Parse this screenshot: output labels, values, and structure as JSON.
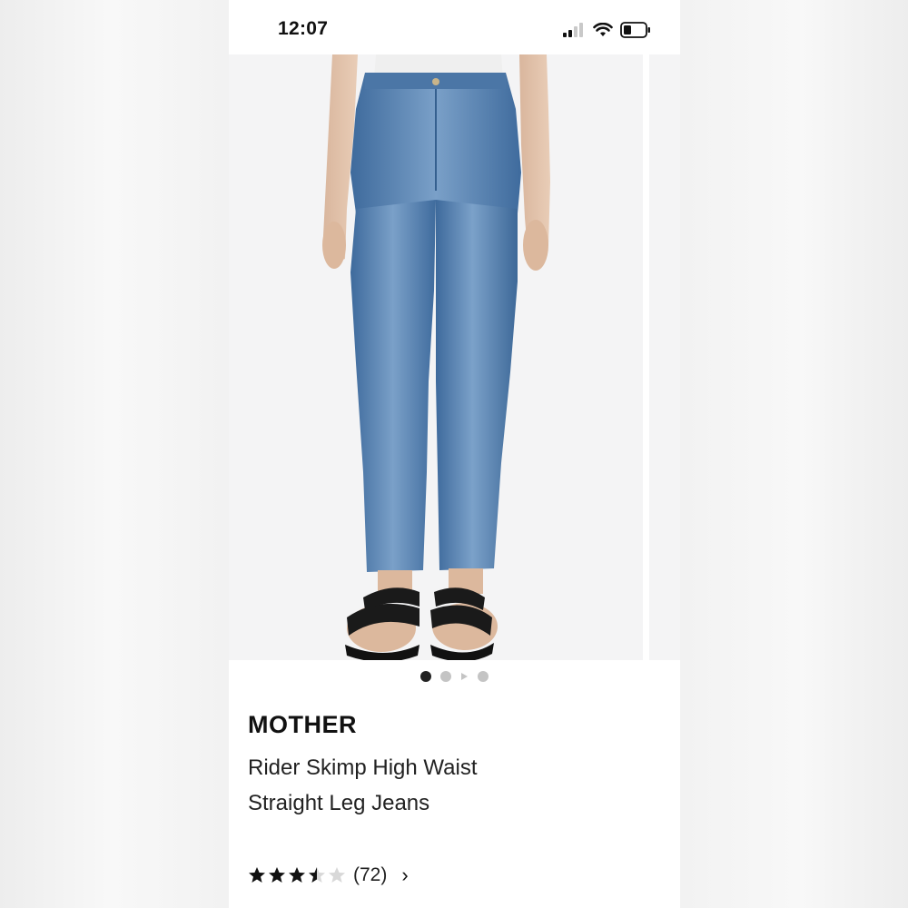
{
  "status_bar": {
    "time": "12:07",
    "icons": [
      "cellular-signal-icon",
      "wifi-icon",
      "battery-icon"
    ]
  },
  "gallery": {
    "image_alt": "Model wearing medium-wash high waist straight leg jeans with black sandals",
    "page_count": 4,
    "active_index": 0,
    "video_index": 2
  },
  "product": {
    "brand": "MOTHER",
    "name": "Rider Skimp High Waist Straight Leg Jeans",
    "rating": 3.5,
    "rating_max": 5,
    "review_count": "(72)"
  },
  "colors": {
    "denim": "#4a75a6",
    "star": "#111111",
    "star_empty": "#d8d8d8"
  }
}
